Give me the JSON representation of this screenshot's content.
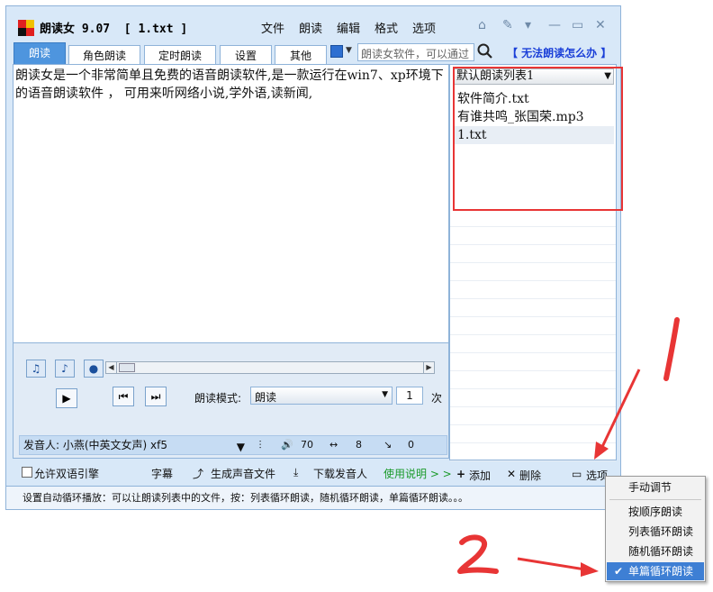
{
  "window": {
    "title": "朗读女 9.07  [ 1.txt ]",
    "menu": [
      "文件",
      "朗读",
      "编辑",
      "格式",
      "选项"
    ]
  },
  "tabs": [
    "朗读",
    "角色朗读",
    "定时朗读",
    "设置",
    "其他"
  ],
  "search": {
    "placeholder": "朗读女软件，可以通过",
    "help_link": "【 无法朗读怎么办 】"
  },
  "editor": {
    "text": "朗读女是一个非常简单且免费的语音朗读软件,是一款运行在win7、xp环境下的语音朗读软件 ， 可用来听网络小说,学外语,读新闻,"
  },
  "controls": {
    "mode_label": "朗读模式:",
    "mode_value": "朗读",
    "repeat_value": "1",
    "repeat_unit": "次",
    "voice": "发音人: 小燕(中英文女声) xf5",
    "volume": "70",
    "speed": "8",
    "pitch": "0",
    "allow_dual_engine": "允许双语引擎",
    "subtitle": "字幕",
    "generate_audio": "生成声音文件",
    "download_voice": "下载发音人",
    "usage_guide": "使用说明 > >"
  },
  "playlist": {
    "selected_list": "默认朗读列表1",
    "items": [
      "软件简介.txt",
      "有谁共鸣_张国荣.mp3",
      "1.txt"
    ],
    "add": "添加",
    "delete": "删除",
    "options": "选项"
  },
  "status": "设置自动循环播放：可以让朗读列表中的文件，按：列表循环朗读，随机循环朗读，单篇循环朗读。。。",
  "popup_menu": {
    "items": [
      "手动调节",
      "按顺序朗读",
      "列表循环朗读",
      "随机循环朗读",
      "单篇循环朗读"
    ],
    "checked": "单篇循环朗读"
  },
  "annotations": [
    "1",
    "2"
  ],
  "colors": {
    "accent": "#4e95de",
    "annotation": "#e83535",
    "link": "#1a3fd8"
  }
}
